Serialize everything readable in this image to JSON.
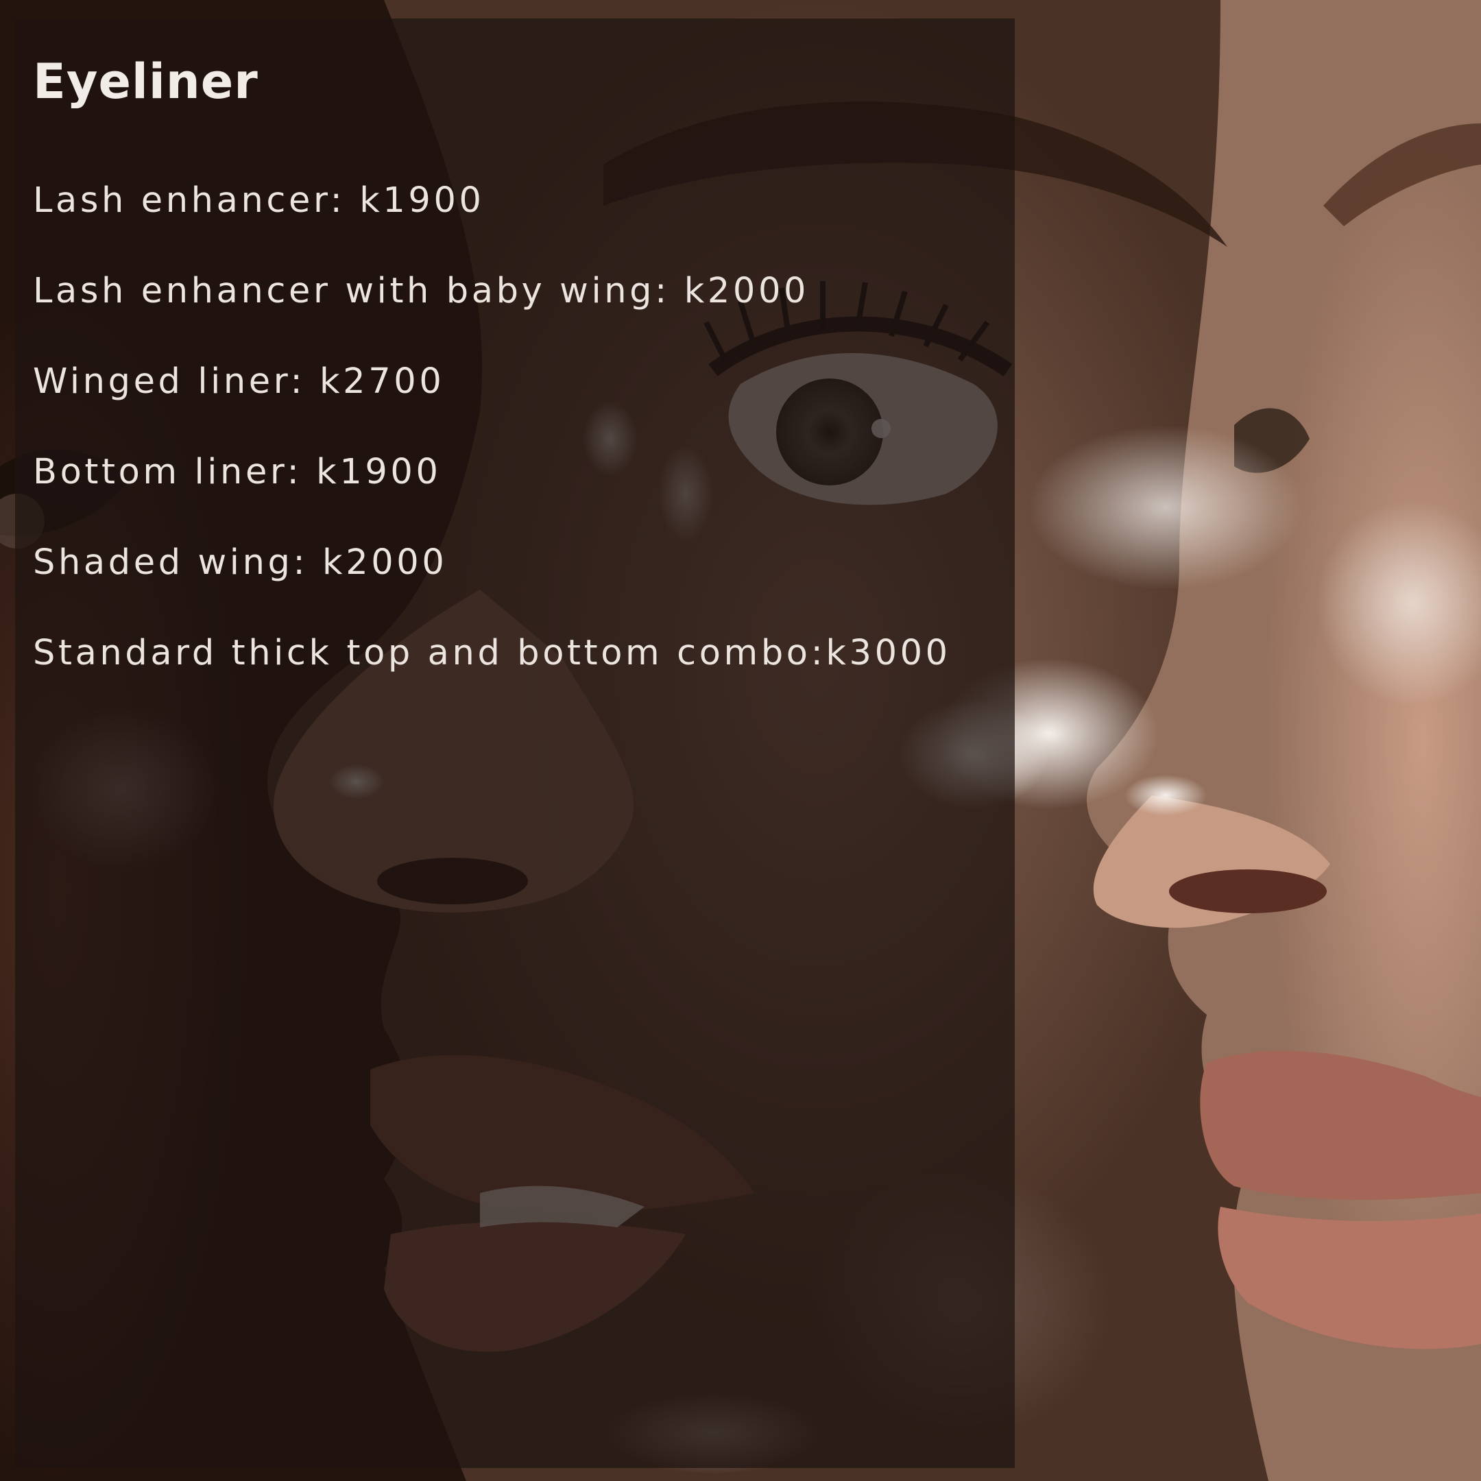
{
  "panel": {
    "title": "Eyeliner",
    "items": [
      "Lash enhancer: k1900",
      "Lash enhancer with baby wing: k2000",
      "Winged liner: k2700",
      "Bottom liner: k1900",
      "Shaded wing: k2000",
      "Standard thick top and bottom combo:k3000"
    ]
  },
  "colors": {
    "panel_overlay": "#1e1410",
    "text": "#ece4df",
    "skin_dark": "#3a2318",
    "skin_mid": "#6e4c3c",
    "skin_light": "#b78a74",
    "highlight": "#f3ece6"
  }
}
